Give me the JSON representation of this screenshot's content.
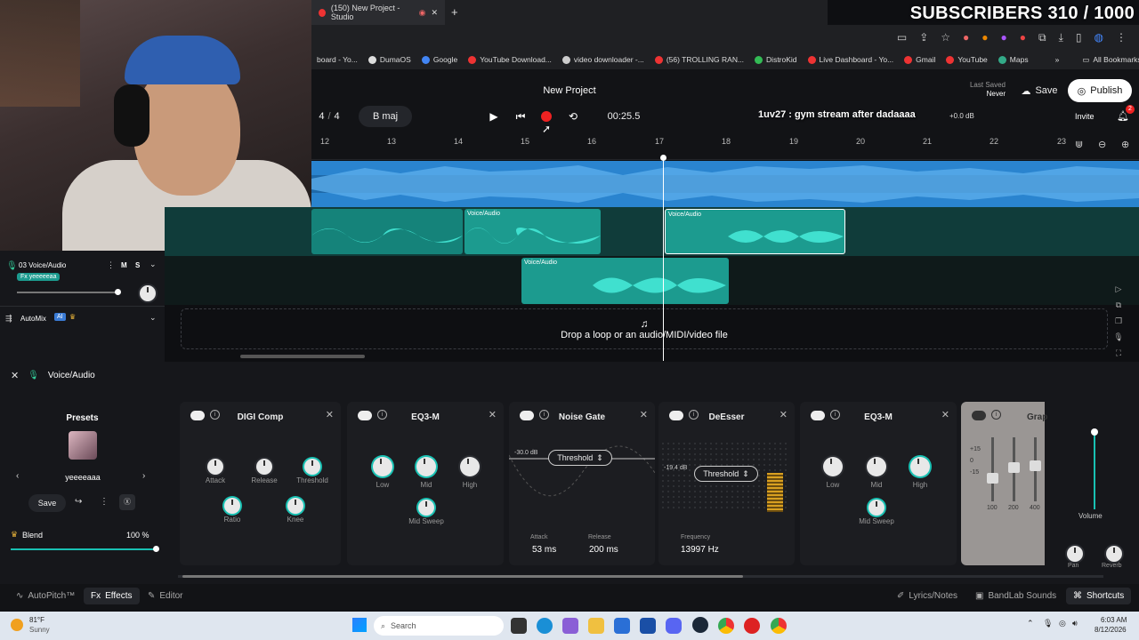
{
  "browser": {
    "tab_title": "(150) New Project - Studio",
    "new_tab_symbol": "+",
    "subscribers_overlay": "SUBSCRIBERS 310 / 1000",
    "bookmarks": [
      {
        "label": "board - Yo...",
        "color": "#e33"
      },
      {
        "label": "DumaOS",
        "color": "#ddd"
      },
      {
        "label": "Google",
        "color": "#4285f4"
      },
      {
        "label": "YouTube Download...",
        "color": "#e33"
      },
      {
        "label": "video downloader -...",
        "color": "#ccc"
      },
      {
        "label": "(56) TROLLING RAN...",
        "color": "#e33"
      },
      {
        "label": "DistroKid",
        "color": "#3b5"
      },
      {
        "label": "Live Dashboard - Yo...",
        "color": "#e33"
      },
      {
        "label": "Gmail",
        "color": "#e33"
      },
      {
        "label": "YouTube",
        "color": "#e33"
      },
      {
        "label": "Maps",
        "color": "#3a8"
      }
    ],
    "all_bookmarks": "All Bookmarks"
  },
  "studio": {
    "project_title": "New Project",
    "last_saved_label": "Last Saved",
    "last_saved_value": "Never",
    "save_label": "Save",
    "publish_label": "Publish",
    "time_signature_top": "4",
    "time_signature_sep": "/",
    "time_signature_bottom": "4",
    "key": "B maj",
    "time_display": "00:25.5",
    "stream_overlay": "1uv27 : gym stream after dadaaaa",
    "master_gain": "+0.0 dB",
    "invite_label": "Invite",
    "notif_count": "2"
  },
  "ruler": [
    "12",
    "13",
    "14",
    "15",
    "16",
    "17",
    "18",
    "19",
    "20",
    "21",
    "22",
    "23"
  ],
  "tracks": {
    "track3_name": "03 Voice/Audio",
    "track3_fx": "Fx yeeeeeaa",
    "mute": "M",
    "solo": "S",
    "clip_label": "Voice/Audio",
    "automix_label": "AutoMix",
    "automix_badge": "AI",
    "drop_text": "Drop a loop or an audio/MIDI/video file"
  },
  "fx_panel": {
    "track_name": "Voice/Audio",
    "presets_title": "Presets",
    "preset_name": "yeeeeaaa",
    "save_label": "Save",
    "blend_label": "Blend",
    "blend_value": "100 %",
    "blend_fraction": 1.0,
    "digicomp": {
      "title": "DIGI Comp",
      "attack": "Attack",
      "release": "Release",
      "threshold": "Threshold",
      "ratio": "Ratio",
      "knee": "Knee"
    },
    "eq3_a": {
      "title": "EQ3-M",
      "low": "Low",
      "mid": "Mid",
      "high": "High",
      "sweep": "Mid Sweep"
    },
    "noisegate": {
      "title": "Noise Gate",
      "db": "-30.0 dB",
      "threshold": "Threshold",
      "attack_label": "Attack",
      "attack_value": "53 ms",
      "release_label": "Release",
      "release_value": "200 ms"
    },
    "deesser": {
      "title": "DeEsser",
      "db": "-19.4 dB",
      "threshold": "Threshold",
      "freq_label": "Frequency",
      "freq_value": "13997 Hz"
    },
    "eq3_b": {
      "title": "EQ3-M",
      "low": "Low",
      "mid": "Mid",
      "high": "High",
      "sweep": "Mid Sweep"
    },
    "graphic": {
      "title": "Grap",
      "scale": [
        "+15",
        "0",
        "-15"
      ],
      "bands": [
        "100",
        "200",
        "400"
      ]
    },
    "volume_label": "Volume",
    "pan_label": "Pan",
    "reverb_label": "Reverb"
  },
  "bottom_tabs": {
    "autopitch": "AutoPitch™",
    "effects": "Effects",
    "editor": "Editor",
    "lyrics": "Lyrics/Notes",
    "sounds": "BandLab Sounds",
    "shortcuts": "Shortcuts"
  },
  "taskbar": {
    "weather_temp": "81°F",
    "weather_desc": "Sunny",
    "search_placeholder": "Search",
    "time": "6:03 AM",
    "date": "8/12/2026"
  }
}
